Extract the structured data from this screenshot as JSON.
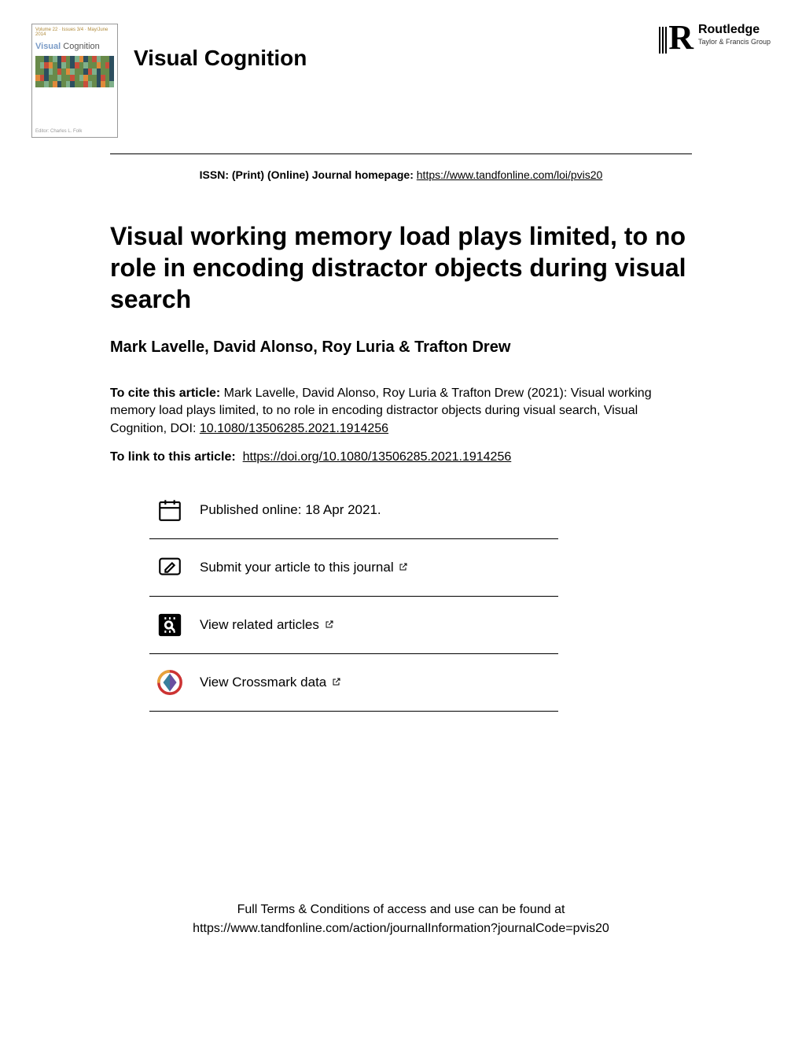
{
  "header": {
    "cover": {
      "meta": "Volume 22 · Issues 3/4 · May/June 2014",
      "title_part1": "Visual",
      "title_part2": "Cognition",
      "editor": "Editor: Charles L. Folk"
    },
    "journal_name": "Visual Cognition",
    "publisher": {
      "name": "Routledge",
      "sub": "Taylor & Francis Group"
    }
  },
  "issn_line": {
    "prefix": "ISSN: (Print) (Online) Journal homepage: ",
    "url": "https://www.tandfonline.com/loi/pvis20"
  },
  "article": {
    "title": "Visual working memory load plays limited, to no role in encoding distractor objects during visual search",
    "authors": "Mark Lavelle, David Alonso, Roy Luria & Trafton Drew"
  },
  "citation": {
    "label": "To cite this article:",
    "text": " Mark Lavelle, David Alonso, Roy Luria & Trafton Drew (2021): Visual working memory load plays limited, to no role in encoding distractor objects during visual search, Visual Cognition, DOI: ",
    "doi": "10.1080/13506285.2021.1914256"
  },
  "link": {
    "label": "To link to this article:",
    "url": "https://doi.org/10.1080/13506285.2021.1914256"
  },
  "actions": {
    "published": "Published online: 18 Apr 2021.",
    "submit": "Submit your article to this journal",
    "related": "View related articles",
    "crossmark": "View Crossmark data"
  },
  "footer": {
    "line1": "Full Terms & Conditions of access and use can be found at",
    "line2": "https://www.tandfonline.com/action/journalInformation?journalCode=pvis20"
  }
}
